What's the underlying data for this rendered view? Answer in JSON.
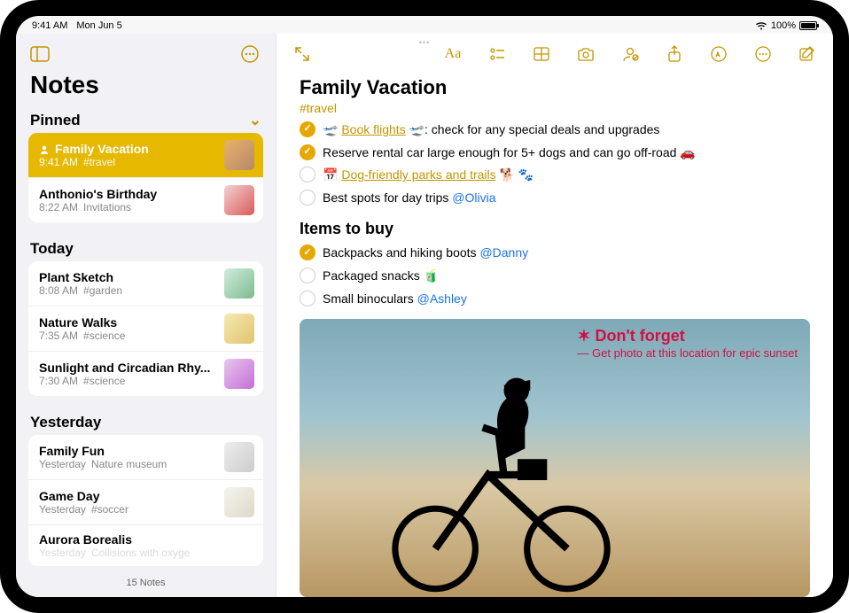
{
  "status": {
    "time": "9:41 AM",
    "date": "Mon Jun 5",
    "battery_pct": "100%"
  },
  "sidebar": {
    "title": "Notes",
    "sections": {
      "pinned": {
        "label": "Pinned",
        "items": [
          {
            "title": "Family Vacation",
            "time": "9:41 AM",
            "tag": "#travel"
          },
          {
            "title": "Anthonio's Birthday",
            "time": "8:22 AM",
            "tag": "Invitations"
          }
        ]
      },
      "today": {
        "label": "Today",
        "items": [
          {
            "title": "Plant Sketch",
            "time": "8:08 AM",
            "tag": "#garden"
          },
          {
            "title": "Nature Walks",
            "time": "7:35 AM",
            "tag": "#science"
          },
          {
            "title": "Sunlight and Circadian Rhy...",
            "time": "7:30 AM",
            "tag": "#science"
          }
        ]
      },
      "yesterday": {
        "label": "Yesterday",
        "items": [
          {
            "title": "Family Fun",
            "time": "Yesterday",
            "tag": "Nature museum"
          },
          {
            "title": "Game Day",
            "time": "Yesterday",
            "tag": "#soccer"
          },
          {
            "title": "Aurora Borealis",
            "time": "Yesterday",
            "tag": "Collisions with oxyge"
          }
        ]
      }
    },
    "footer_count": "15 Notes"
  },
  "note": {
    "title": "Family Vacation",
    "tag": "#travel",
    "todo": [
      {
        "checked": true,
        "pre_emoji": "🛫",
        "link": "Book flights",
        "post_emoji": "🛫",
        "rest": ": check for any special deals and upgrades"
      },
      {
        "checked": true,
        "text": "Reserve rental car large enough for 5+ dogs and can go off-road 🚗"
      },
      {
        "checked": false,
        "pre_emoji": "📅",
        "link": "Dog-friendly parks and trails",
        "post_emoji": " 🐕 🐾"
      },
      {
        "checked": false,
        "text": "Best spots for day trips ",
        "mention": "@Olivia"
      }
    ],
    "buy_heading": "Items to buy",
    "buy": [
      {
        "checked": true,
        "text": "Backpacks and hiking boots ",
        "mention": "@Danny"
      },
      {
        "checked": false,
        "text": "Packaged snacks 🧃"
      },
      {
        "checked": false,
        "text": "Small binoculars ",
        "mention": "@Ashley"
      }
    ],
    "handwriting_main": "✶ Don't forget",
    "handwriting_sub": "— Get photo at this location for epic sunset"
  }
}
